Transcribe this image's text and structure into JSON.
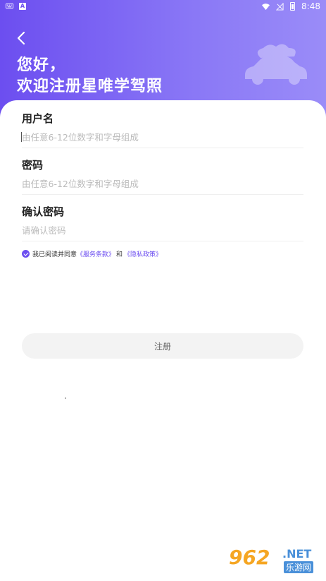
{
  "status_bar": {
    "time": "8:48",
    "left_icons": [
      "keyboard-icon",
      "a-icon"
    ],
    "right_icons": [
      "wifi-icon",
      "no-signal-icon",
      "battery-icon"
    ]
  },
  "header": {
    "greeting_line1": "您好，",
    "greeting_line2": "欢迎注册星唯学驾照",
    "illustration": "car-icon",
    "bg_color": "#6c4ef0"
  },
  "form": {
    "username": {
      "label": "用户名",
      "placeholder": "由任意6-12位数字和字母组成",
      "value": ""
    },
    "password": {
      "label": "密码",
      "placeholder": "由任意6-12位数字和字母组成",
      "value": ""
    },
    "confirm_password": {
      "label": "确认密码",
      "placeholder": "请确认密码",
      "value": ""
    }
  },
  "agreement": {
    "checked": true,
    "prefix": "我已阅读并同意",
    "terms_link": "《服务条款》",
    "and": "和",
    "privacy_link": "《隐私政策》"
  },
  "register_button": {
    "label": "注册"
  },
  "watermark": {
    "number": "962",
    "suffix": ".NET",
    "cn": "乐游网"
  },
  "colors": {
    "accent": "#6c4ef0",
    "button_bg": "#f3f3f3"
  }
}
